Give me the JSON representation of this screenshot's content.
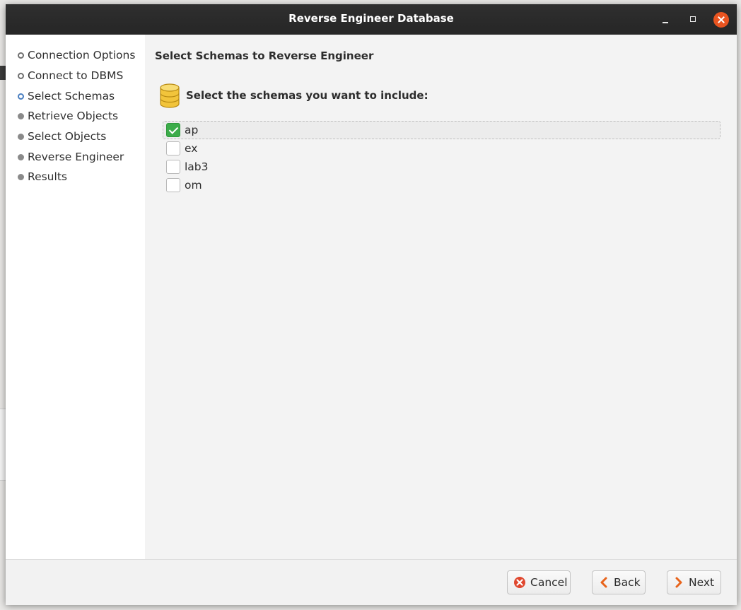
{
  "window": {
    "title": "Reverse Engineer Database"
  },
  "sidebar": {
    "steps": [
      {
        "label": "Connection Options",
        "state": "done"
      },
      {
        "label": "Connect to DBMS",
        "state": "done"
      },
      {
        "label": "Select Schemas",
        "state": "current"
      },
      {
        "label": "Retrieve Objects",
        "state": "pending"
      },
      {
        "label": "Select Objects",
        "state": "pending"
      },
      {
        "label": "Reverse Engineer",
        "state": "pending"
      },
      {
        "label": "Results",
        "state": "pending"
      }
    ]
  },
  "main": {
    "title": "Select Schemas to Reverse Engineer",
    "instruction": "Select the schemas you want to include:",
    "icon": "database-icon",
    "schemas": [
      {
        "name": "ap",
        "checked": true
      },
      {
        "name": "ex",
        "checked": false
      },
      {
        "name": "lab3",
        "checked": false
      },
      {
        "name": "om",
        "checked": false
      }
    ]
  },
  "footer": {
    "cancel_label": "Cancel",
    "back_label": "Back",
    "next_label": "Next"
  },
  "colors": {
    "close_button": "#e95420",
    "checkbox_checked": "#3cac4a",
    "current_step_bullet": "#4a7fc1",
    "cancel_icon": "#e0472e",
    "nav_arrow": "#e8641c",
    "database_icon": "#f2c43b"
  }
}
